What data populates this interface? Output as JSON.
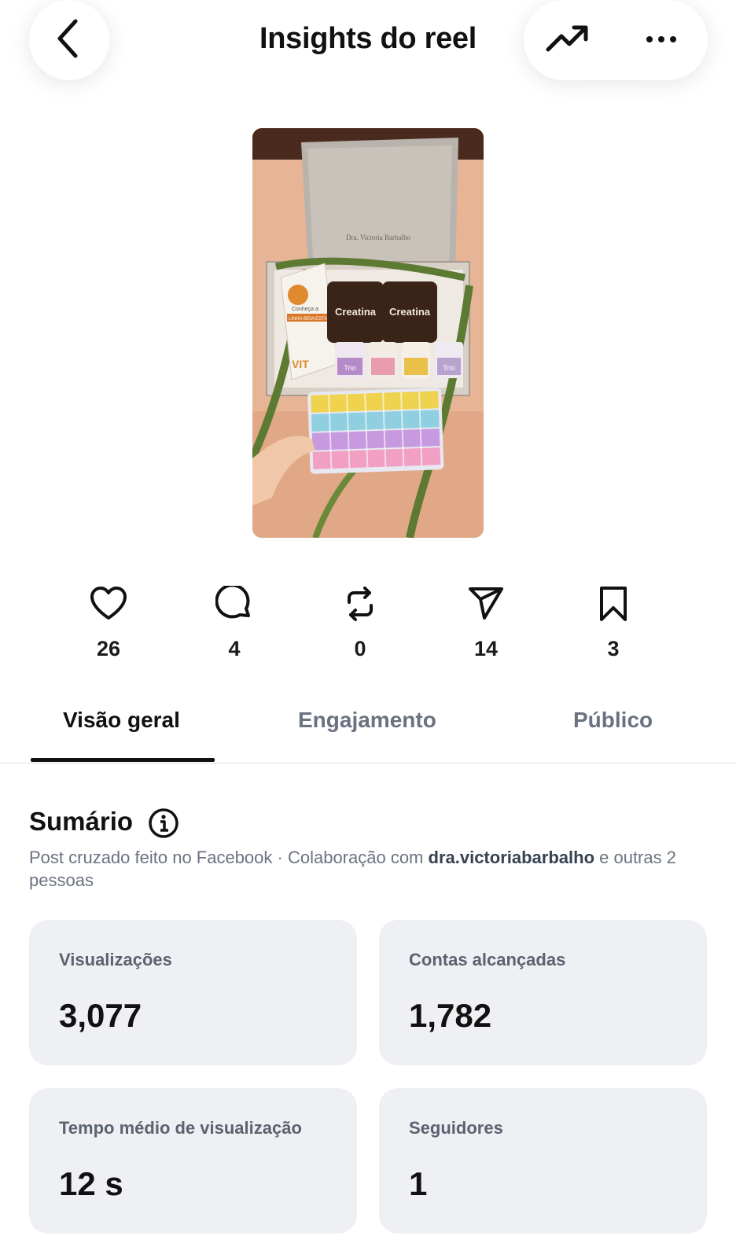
{
  "header": {
    "title": "Insights do reel",
    "back_icon": "chevron-left-icon",
    "trend_icon": "trending-up-icon",
    "more_icon": "more-horizontal-icon"
  },
  "media": {
    "thumbnail_icon": "reel-thumbnail",
    "texts": {
      "creatina_left": "Creatina",
      "creatina_right": "Creatina",
      "trio_1": "Trio",
      "trio_2": "Trio",
      "box_brand": "Dra. Victoria Barbalho",
      "card_title": "Conheça a",
      "card_banner": "LINHA BEM-ESTAR",
      "vit": "VIT"
    }
  },
  "stats": [
    {
      "icon": "heart-icon",
      "value": "26"
    },
    {
      "icon": "comment-icon",
      "value": "4"
    },
    {
      "icon": "repost-icon",
      "value": "0"
    },
    {
      "icon": "share-icon",
      "value": "14"
    },
    {
      "icon": "bookmark-icon",
      "value": "3"
    }
  ],
  "tabs": [
    {
      "label": "Visão geral",
      "active": true
    },
    {
      "label": "Engajamento",
      "active": false
    },
    {
      "label": "Público",
      "active": false
    }
  ],
  "summary": {
    "title": "Sumário",
    "info_icon": "info-icon",
    "description_prefix": "Post cruzado feito no Facebook · Colaboração com ",
    "collaborator": "dra.victoriabarbalho",
    "description_suffix": " e outras 2 pessoas"
  },
  "metrics": [
    {
      "label": "Visualizações",
      "value": "3,077"
    },
    {
      "label": "Contas alcançadas",
      "value": "1,782"
    },
    {
      "label": "Tempo médio de visualização",
      "value": "12 s"
    },
    {
      "label": "Seguidores",
      "value": "1"
    }
  ],
  "colors": {
    "card_bg": "#eff0f3",
    "text_primary": "#111111",
    "text_secondary": "#6b7280",
    "ribbon": "#5d7a32"
  }
}
